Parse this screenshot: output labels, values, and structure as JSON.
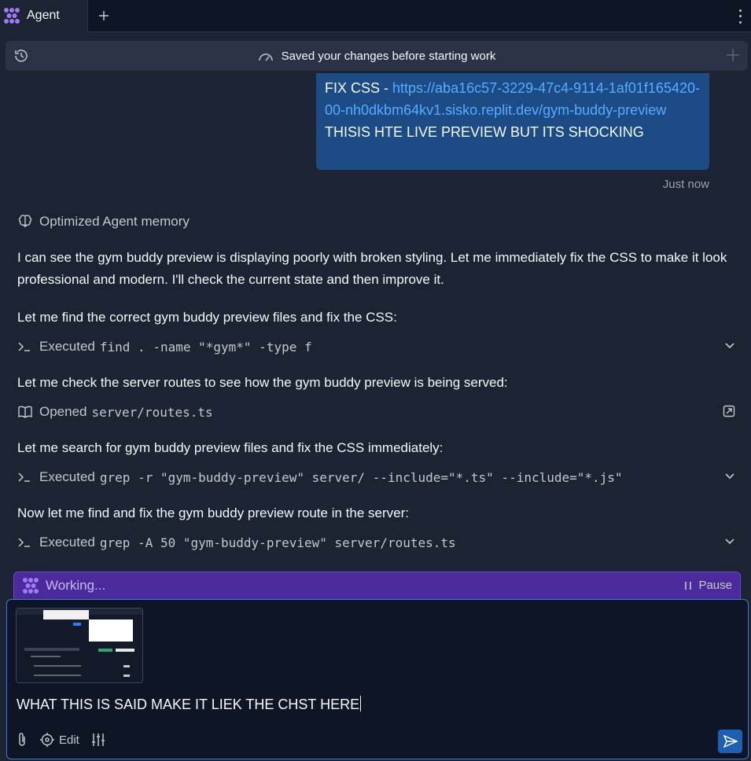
{
  "tabbar": {
    "tab_label": "Agent",
    "new_tab": "+"
  },
  "banner": {
    "text": "Saved your changes before starting work"
  },
  "user_message": {
    "prefix": "FIX CSS - ",
    "link": "https://aba16c57-3229-47c4-9114-1af01f165420-00-nh0dkbm64kv1.sisko.replit.dev/gym-buddy-preview",
    "suffix": " THISIS HTE LIVE PREVIEW BUT ITS SHOCKING",
    "timestamp": "Just now"
  },
  "agent": {
    "memory_label": "Optimized Agent memory",
    "intro": "I can see the gym buddy preview is displaying poorly with broken styling. Let me immediately fix the CSS to make it look professional and modern. I'll check the current state and then improve it.",
    "steps": [
      {
        "text": "Let me find the correct gym buddy preview files and fix the CSS:",
        "action": "Executed",
        "code": "find . -name \"*gym*\" -type f"
      },
      {
        "text": "Let me check the server routes to see how the gym buddy preview is being served:",
        "action": "Opened",
        "code": "server/routes.ts"
      },
      {
        "text": "Let me search for gym buddy preview files and fix the CSS immediately:",
        "action": "Executed",
        "code": "grep -r \"gym-buddy-preview\" server/ --include=\"*.ts\" --include=\"*.js\""
      },
      {
        "text": "Now let me find and fix the gym buddy preview route in the server:",
        "action": "Executed",
        "code": "grep -A 50 \"gym-buddy-preview\" server/routes.ts"
      }
    ]
  },
  "working": {
    "label": "Working...",
    "pause_label": "Pause"
  },
  "composer": {
    "text": "WHAT THIS IS SAID MAKE IT LIEK THE CHST HERE",
    "edit_label": "Edit"
  },
  "colors": {
    "accent": "#1d4b86",
    "link": "#57abff",
    "working": "#4b2b9b"
  }
}
